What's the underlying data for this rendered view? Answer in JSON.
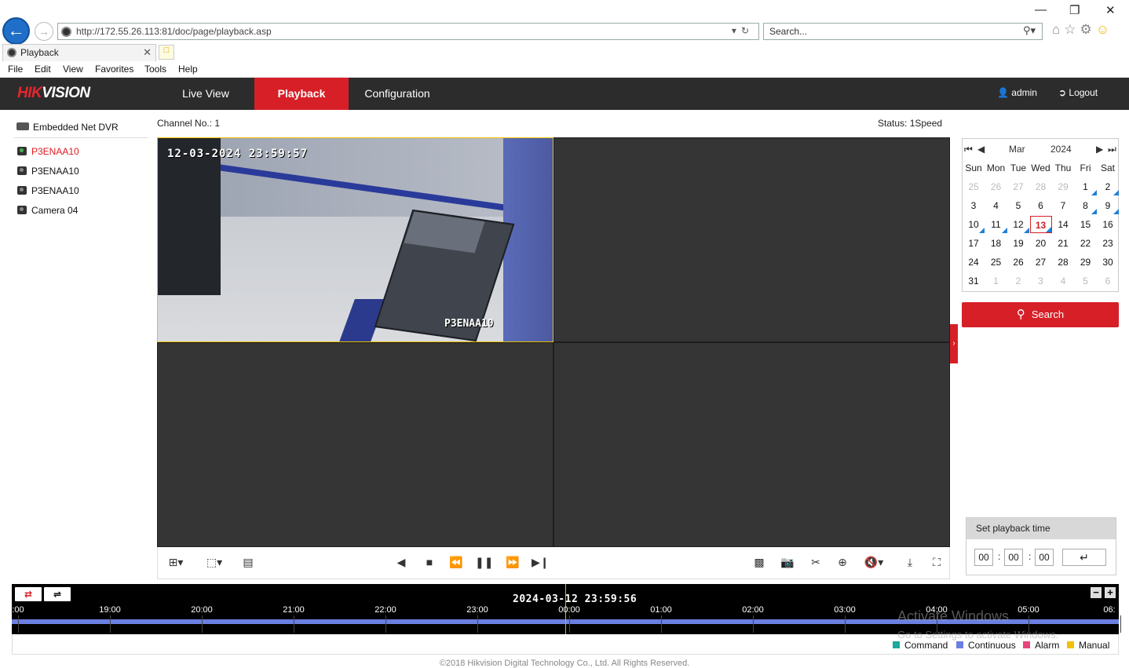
{
  "browser": {
    "url": "http://172.55.26.113:81/doc/page/playback.asp",
    "search_placeholder": "Search...",
    "tab_title": "Playback",
    "menu": [
      "File",
      "Edit",
      "View",
      "Favorites",
      "Tools",
      "Help"
    ]
  },
  "app": {
    "logo": "HIKVISION",
    "nav": [
      "Live View",
      "Playback",
      "Configuration"
    ],
    "active_nav": "Playback",
    "user": "admin",
    "logout": "Logout"
  },
  "tree": {
    "root": "Embedded Net DVR",
    "cameras": [
      {
        "name": "P3ENAA10",
        "selected": true
      },
      {
        "name": "P3ENAA10",
        "selected": false
      },
      {
        "name": "P3ENAA10",
        "selected": false
      },
      {
        "name": "Camera 04",
        "selected": false
      }
    ]
  },
  "player": {
    "channel": "Channel No.: 1",
    "status": "Status: 1Speed",
    "osd_time": "12-03-2024 23:59:57",
    "osd_name": "P3ENAA10"
  },
  "calendar": {
    "month": "Mar",
    "year": "2024",
    "dow": [
      "Sun",
      "Mon",
      "Tue",
      "Wed",
      "Thu",
      "Fri",
      "Sat"
    ],
    "weeks": [
      [
        "25",
        "26",
        "27",
        "28",
        "29",
        "1",
        "2"
      ],
      [
        "3",
        "4",
        "5",
        "6",
        "7",
        "8",
        "9"
      ],
      [
        "10",
        "11",
        "12",
        "13",
        "14",
        "15",
        "16"
      ],
      [
        "17",
        "18",
        "19",
        "20",
        "21",
        "22",
        "23"
      ],
      [
        "24",
        "25",
        "26",
        "27",
        "28",
        "29",
        "30"
      ],
      [
        "31",
        "1",
        "2",
        "3",
        "4",
        "5",
        "6"
      ]
    ],
    "today": "13",
    "search_label": "Search"
  },
  "playback_time": {
    "title": "Set playback time",
    "hh": "00",
    "mm": "00",
    "ss": "00"
  },
  "timeline": {
    "current": "2024-03-12 23:59:56",
    "ticks": [
      ":00",
      "19:00",
      "20:00",
      "21:00",
      "22:00",
      "23:00",
      "00:00",
      "01:00",
      "02:00",
      "03:00",
      "04:00",
      "05:00",
      "06:"
    ]
  },
  "legend": {
    "items": [
      {
        "label": "Command",
        "color": "#1aa99a"
      },
      {
        "label": "Continuous",
        "color": "#6b7fe0"
      },
      {
        "label": "Alarm",
        "color": "#e8467a"
      },
      {
        "label": "Manual",
        "color": "#f2c200"
      }
    ]
  },
  "footer": "©2018 Hikvision Digital Technology Co., Ltd. All Rights Reserved.",
  "watermark": {
    "line1": "Activate Windows",
    "line2": "Go to Settings to activate Windows."
  }
}
